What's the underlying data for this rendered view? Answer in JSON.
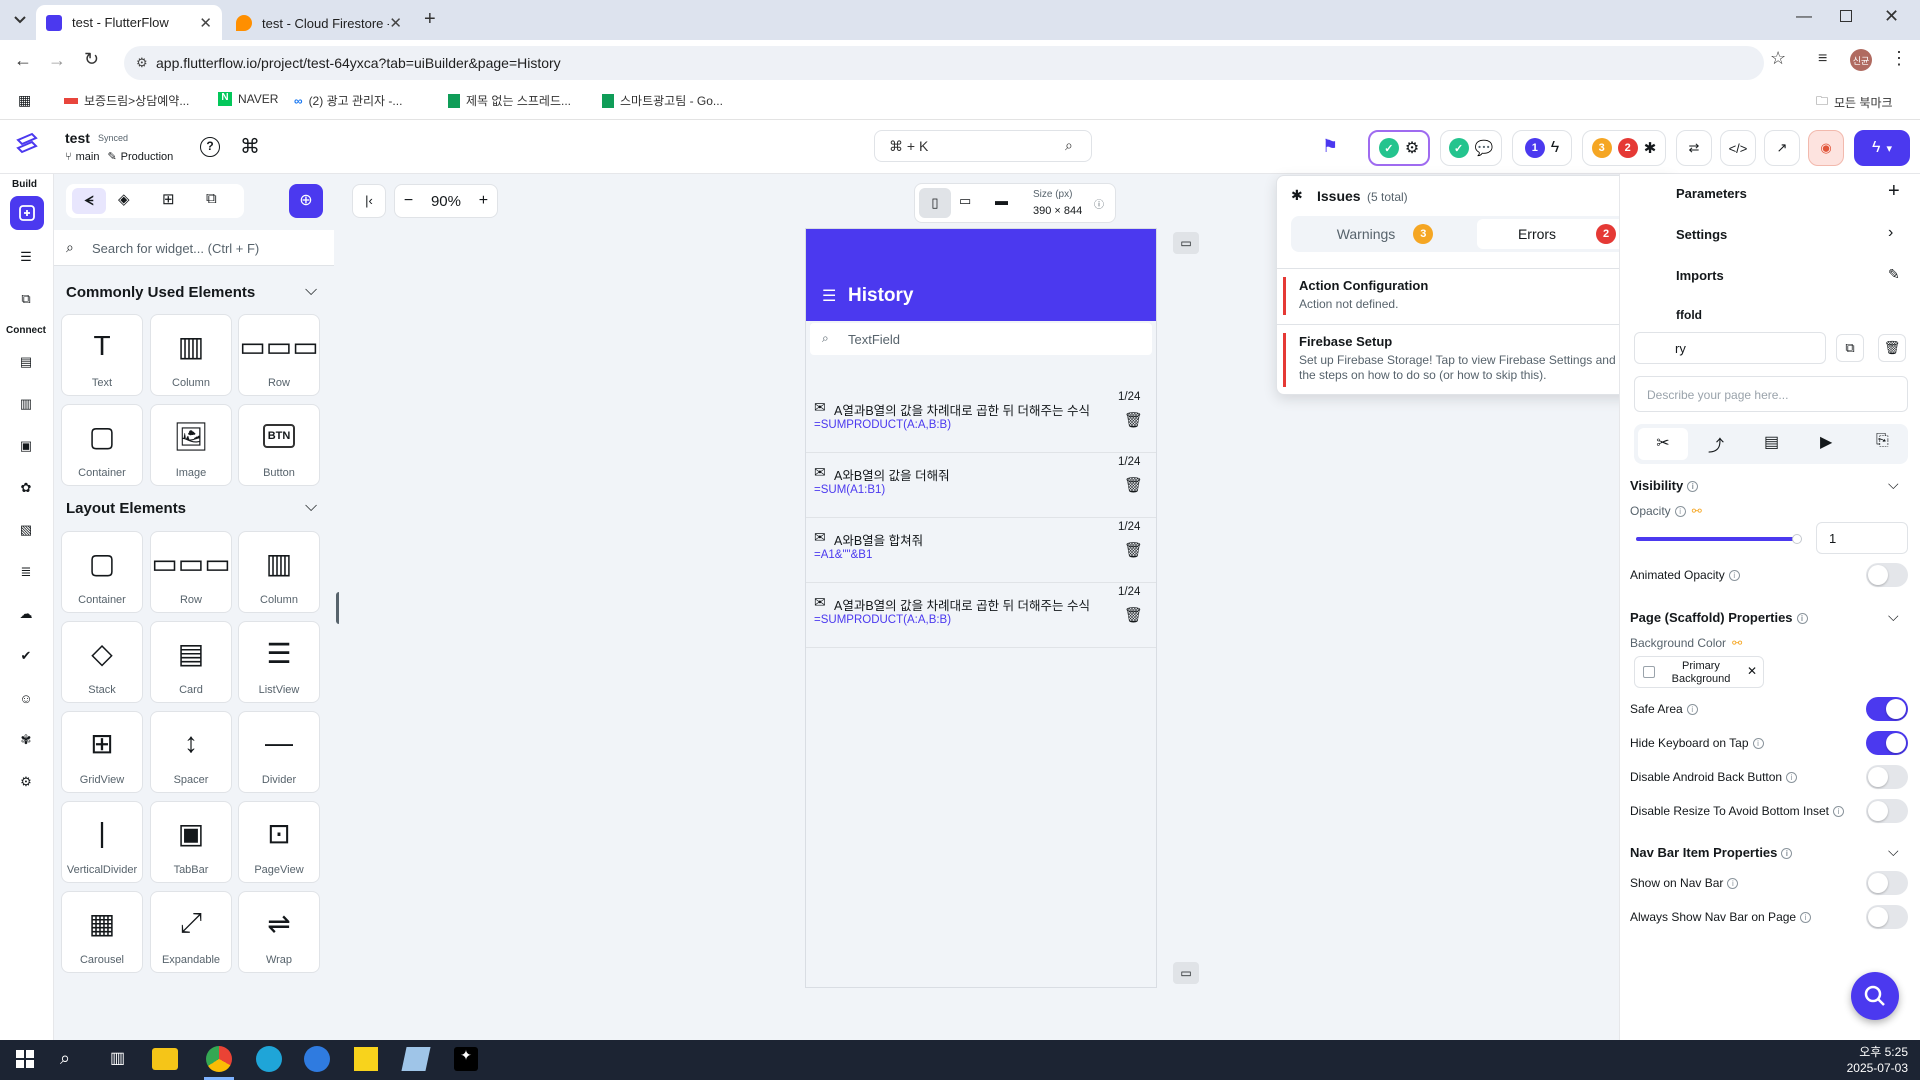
{
  "browser": {
    "tabs": [
      {
        "title": "test - FlutterFlow",
        "active": true
      },
      {
        "title": "test - Cloud Firestore - 데이터",
        "active": false
      }
    ],
    "url": "app.flutterflow.io/project/test-64yxca?tab=uiBuilder&page=History",
    "bookmarks": [
      "보증드림>상담예약...",
      "NAVER",
      "(2) 광고 관리자 -...",
      "제목 없는 스프레드...",
      "스마트광고팀 - Go..."
    ],
    "all_bookmarks": "모든 북마크",
    "profile": "신균"
  },
  "project": {
    "name": "test",
    "sync": "Synced",
    "branch": "main",
    "env": "Production"
  },
  "command_search": "⌘ + K",
  "top_badges": {
    "one": "1",
    "warn": "3",
    "err": "2"
  },
  "rail": {
    "build": "Build",
    "connect": "Connect"
  },
  "widgets": {
    "search_placeholder": "Search for widget... (Ctrl + F)",
    "common_title": "Commonly Used Elements",
    "common": [
      "Text",
      "Column",
      "Row",
      "Container",
      "Image",
      "Button"
    ],
    "layout_title": "Layout Elements",
    "layout": [
      "Container",
      "Row",
      "Column",
      "Stack",
      "Card",
      "ListView",
      "GridView",
      "Spacer",
      "Divider",
      "VerticalDivider",
      "TabBar",
      "PageView",
      "Carousel",
      "Expandable",
      "Wrap"
    ]
  },
  "canvas": {
    "zoom": "90%",
    "size_label": "Size (px)",
    "size_value": "390 × 844",
    "app_title": "History",
    "textfield": "TextField",
    "rows": [
      {
        "title": "A열과B열의 값을 차례대로 곱한 뒤 더해주는 수식",
        "formula": "=SUMPRODUCT(A:A,B:B)",
        "date": "1/24"
      },
      {
        "title": "A와B열의 값을 더해줘",
        "formula": "=SUM(A1:B1)",
        "date": "1/24"
      },
      {
        "title": "A와B열을 합쳐줘",
        "formula": "=A1&\"\"&B1",
        "date": "1/24"
      },
      {
        "title": "A열과B열의 값을 차례대로 곱한 뒤 더해주는 수식",
        "formula": "=SUMPRODUCT(A:A,B:B)",
        "date": "1/24"
      }
    ]
  },
  "issues": {
    "title": "Issues",
    "total": "(5 total)",
    "warnings_label": "Warnings",
    "warnings_count": "3",
    "errors_label": "Errors",
    "errors_count": "2",
    "items": [
      {
        "title": "Action Configuration",
        "desc": "Action not defined."
      },
      {
        "title": "Firebase Setup",
        "desc": "Set up Firebase Storage! Tap to view Firebase Settings and follow the steps on how to do so (or how to skip this)."
      }
    ]
  },
  "props": {
    "parameters": "Parameters",
    "settings": "Settings",
    "imports": "Imports",
    "scaffold": "ffold",
    "page_name": "ry",
    "describe_placeholder": "Describe your page here...",
    "visibility": "Visibility",
    "opacity_label": "Opacity",
    "opacity_value": "1",
    "opacity_fraction": 1,
    "animated_opacity": "Animated Opacity",
    "page_props": "Page (Scaffold) Properties",
    "bg_color_label": "Background Color",
    "bg_color_value": "Primary Background",
    "toggles": [
      {
        "label": "Safe Area",
        "on": true
      },
      {
        "label": "Hide Keyboard on Tap",
        "on": true
      },
      {
        "label": "Disable Android Back Button",
        "on": false
      },
      {
        "label": "Disable Resize To Avoid Bottom Inset",
        "on": false
      }
    ],
    "nav_props": "Nav Bar Item Properties",
    "nav_toggles": [
      {
        "label": "Show on Nav Bar",
        "on": false
      },
      {
        "label": "Always Show Nav Bar on Page",
        "on": false
      }
    ]
  },
  "taskbar": {
    "time": "오후 5:25",
    "date": "2025-07-03"
  },
  "colors": {
    "primary": "#4b39ef",
    "warning": "#f5a623",
    "error": "#e53935",
    "success": "#24c48e"
  }
}
